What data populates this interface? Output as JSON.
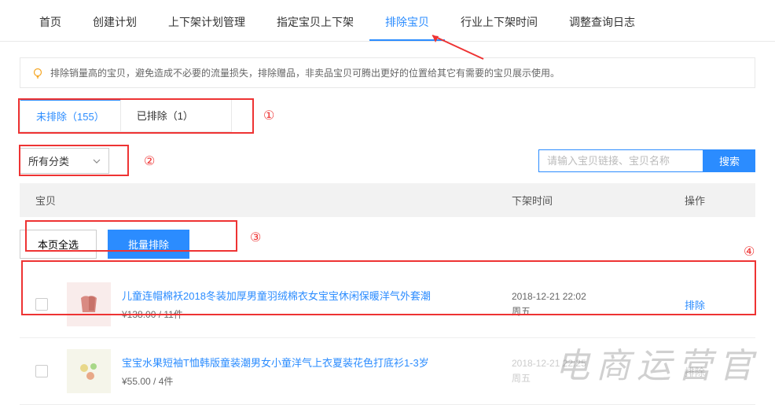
{
  "nav": {
    "items": [
      "首页",
      "创建计划",
      "上下架计划管理",
      "指定宝贝上下架",
      "排除宝贝",
      "行业上下架时间",
      "调整查询日志"
    ],
    "active": 4
  },
  "tip": {
    "text": "排除销量高的宝贝，避免造成不必要的流量损失，排除赠品，非卖品宝贝可腾出更好的位置给其它有需要的宝贝展示使用。"
  },
  "tabs": {
    "items": [
      "未排除（155）",
      "已排除（1）"
    ],
    "active": 0
  },
  "filter": {
    "category_label": "所有分类",
    "search_placeholder": "请输入宝贝链接、宝贝名称",
    "search_btn": "搜索"
  },
  "table": {
    "headers": {
      "item": "宝贝",
      "time": "下架时间",
      "op": "操作"
    }
  },
  "batch": {
    "select_all": "本页全选",
    "batch_exclude": "批量排除"
  },
  "products": [
    {
      "title": "儿童连帽棉袄2018冬装加厚男童羽绒棉衣女宝宝休闲保暖洋气外套潮",
      "price": "¥138.00 / 11件",
      "time": "2018-12-21 22:02",
      "day": "周五",
      "op": "排除",
      "thumb_bg": "#f9eceb"
    },
    {
      "title": "宝宝水果短袖T恤韩版童装潮男女小童洋气上衣夏装花色打底衫1-3岁",
      "price": "¥55.00 / 4件",
      "time": "2018-12-21 22:25",
      "day": "周五",
      "op": "排除",
      "thumb_bg": "#f5f5ea"
    }
  ],
  "annotations": {
    "n1": "①",
    "n2": "②",
    "n3": "③",
    "n4": "④"
  },
  "watermark": "电商运营官"
}
